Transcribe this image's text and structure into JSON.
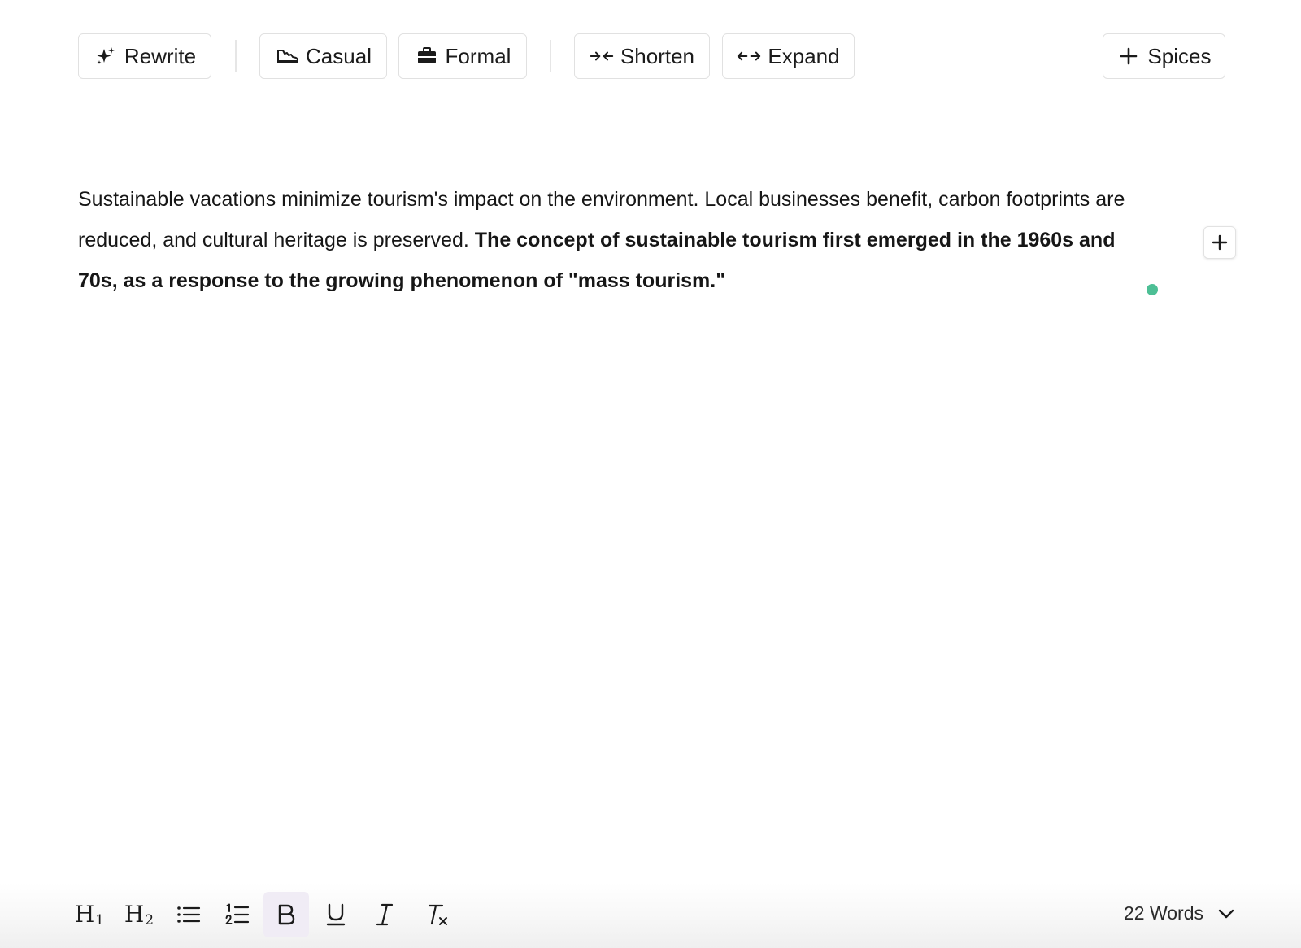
{
  "toolbar": {
    "rewrite": {
      "label": "Rewrite",
      "icon": "sparkle-icon"
    },
    "casual": {
      "label": "Casual",
      "icon": "sneaker-icon"
    },
    "formal": {
      "label": "Formal",
      "icon": "briefcase-icon"
    },
    "shorten": {
      "label": "Shorten",
      "icon": "arrows-inward-icon"
    },
    "expand": {
      "label": "Expand",
      "icon": "arrows-outward-icon"
    },
    "spices": {
      "label": "Spices",
      "icon": "plus-icon"
    }
  },
  "editor": {
    "normal_text": "Sustainable vacations minimize tourism's impact on the environment. Local businesses benefit, carbon footprints are reduced, and cultural heritage is preserved. ",
    "bold_text": "The concept of sustainable tourism first emerged in the 1960s and 70s, as a response to the growing phenomenon of \"mass tourism.\""
  },
  "format_bar": {
    "h1": {
      "main": "H",
      "sub": "1"
    },
    "h2": {
      "main": "H",
      "sub": "2"
    },
    "bold_active": true,
    "word_count": "22 Words"
  },
  "colors": {
    "accent_dot": "#4dbf95",
    "active_button_bg": "#f0ecf5"
  }
}
